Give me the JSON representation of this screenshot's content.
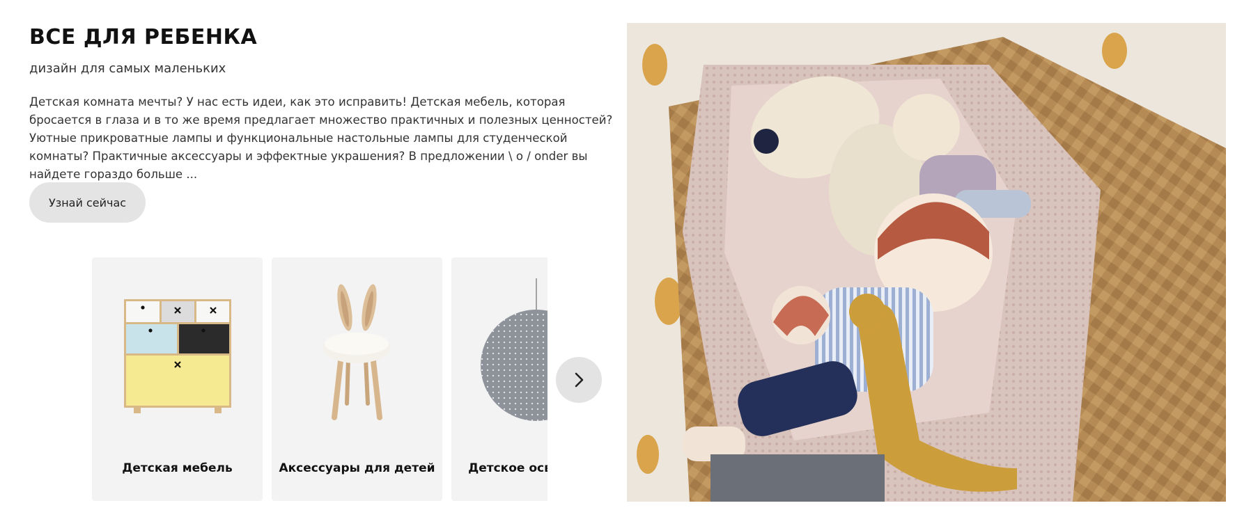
{
  "section": {
    "title": "ВСЕ ДЛЯ РЕБЕНКА",
    "subtitle": "дизайн для самых маленьких",
    "description": "Детская комната мечты? У нас есть идеи, как это исправить! Детская мебель, которая бросается в глаза и в то же время предлагает множество практичных и полезных ценностей? Уютные прикроватные лампы и функциональные настольные лампы для студенческой комнаты? Практичные аксессуары и эффектные украшения? В предложении \\ o / onder вы найдете гораздо больше ...",
    "cta_label": "Узнай сейчас"
  },
  "carousel": {
    "cards": [
      {
        "label": "Детская мебель",
        "icon": "kids-dresser-image"
      },
      {
        "label": "Аксессуары для детей",
        "icon": "bunny-chair-image"
      },
      {
        "label": "Детское освещение",
        "icon": "pendant-lamp-image"
      }
    ],
    "next_icon": "chevron-right-icon"
  },
  "hero_image": {
    "subject": "plush-toys-in-wicker-basket-photo"
  },
  "colors": {
    "card_background": "#f3f3f3",
    "button_background": "#e4e4e4",
    "text": "#111111"
  }
}
